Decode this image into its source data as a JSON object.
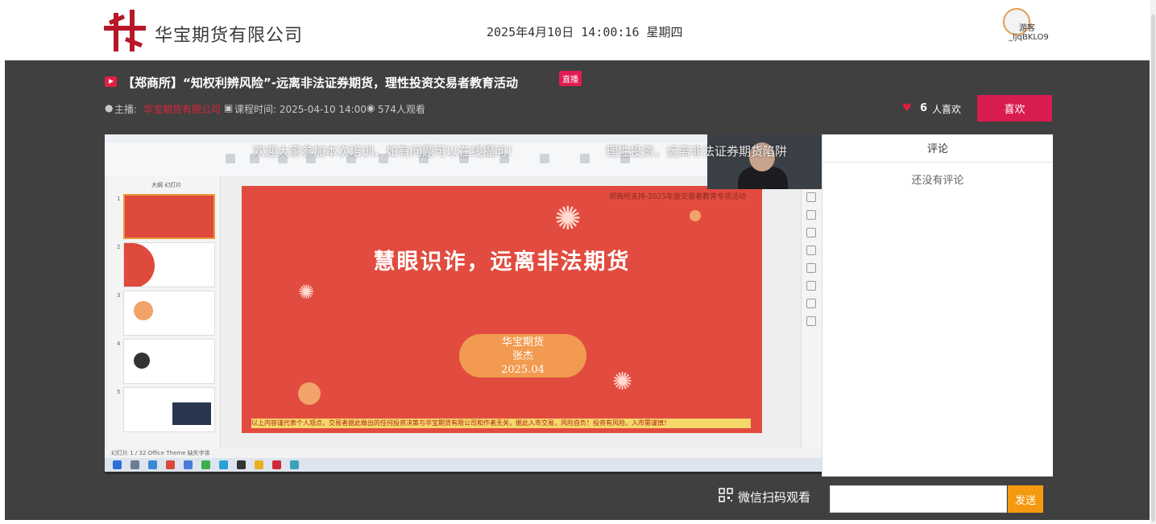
{
  "header": {
    "company_name": "华宝期货有限公司",
    "datetime": "2025年4月10日 14:00:16 星期四",
    "user_avatar_label": "游客",
    "user_id": "_ljqBKLO9"
  },
  "live": {
    "title": "【郑商所】“知权利辨风险”-远离非法证券期货，理性投资交易者教育活动",
    "badge": "直播",
    "host_label": "主播:",
    "host_name": "华宝期货有限公司",
    "course_time": "课程时间: 2025-04-10 14:00",
    "viewers": "574人观看",
    "like_count": "6",
    "like_unit": "人喜欢",
    "like_button": "喜欢"
  },
  "video": {
    "marquee_left": "欢迎大家参加本次培训，如有问题可以在线提问！",
    "marquee_right": "理性投资，远离非法证券期货陷阱",
    "slide_header": "郑商所支持-2025年度交易者教育专项活动",
    "slide_title": "慧眼识诈，远离非法期货",
    "slide_pill": [
      "华宝期货",
      "张杰",
      "2025.04"
    ],
    "slide_footer": "以上内容谨代表个人观点，交易者据此做出的任何投资决策与华宝期货有限公司和作者无关，据此入市交易，风险自负！投资有风险，入市需谨慎！",
    "thumbs_tabs": "大纲   幻灯片",
    "thumb_numbers": [
      "1",
      "2",
      "3",
      "4",
      "5"
    ],
    "status_text": "幻灯片 1 / 32    Office Theme    缺失字体",
    "qr_label": "微信扫码观看"
  },
  "comments": {
    "title": "评论",
    "empty": "还没有评论",
    "input_placeholder": "",
    "send": "发送"
  },
  "colors": {
    "accent": "#d81c50",
    "send": "#f59a10",
    "dark_bg": "#404040",
    "slide_red": "#e24b3f"
  }
}
